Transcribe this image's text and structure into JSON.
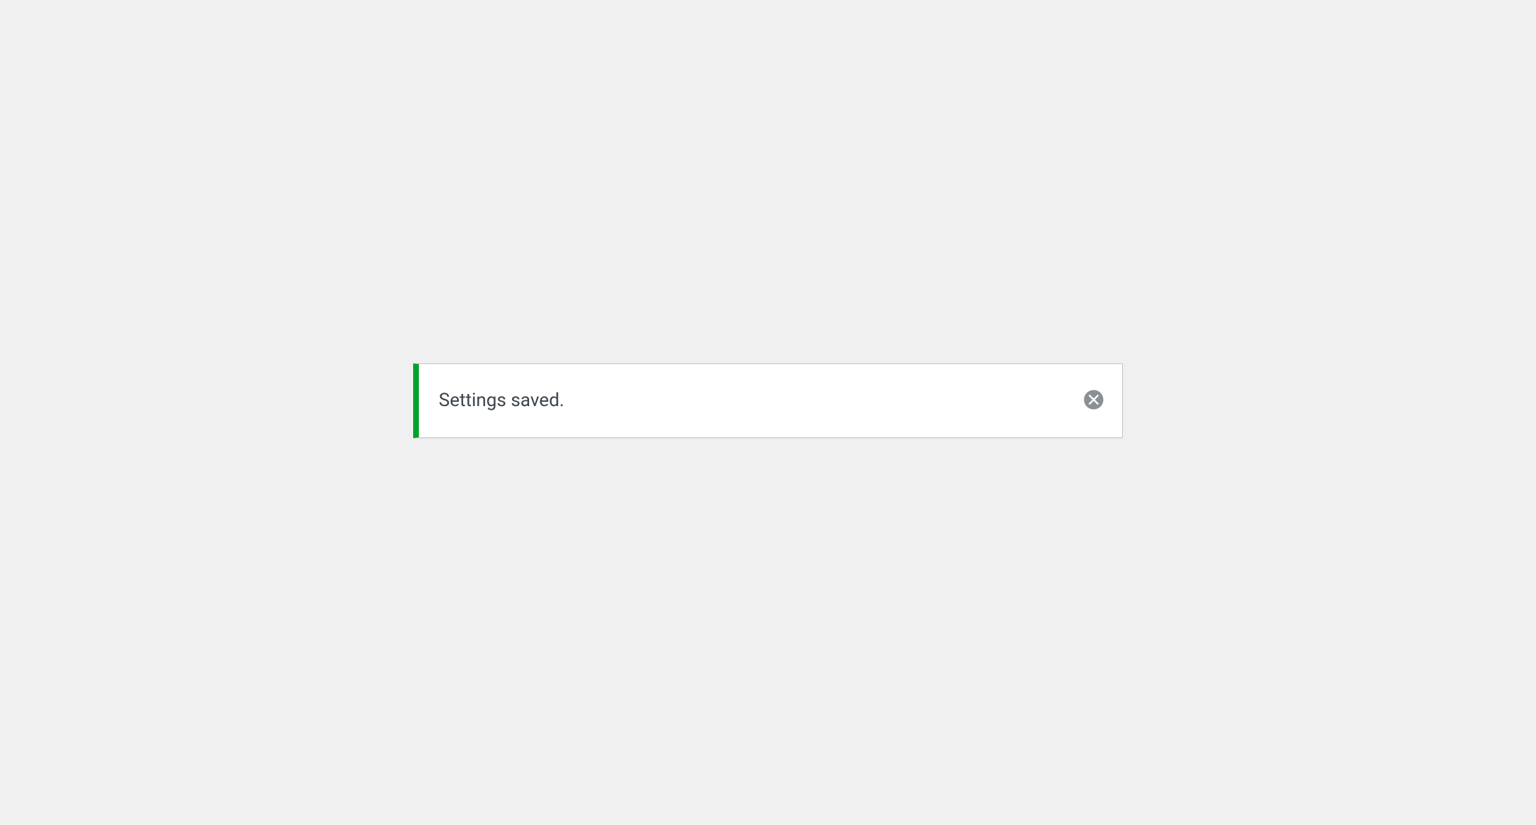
{
  "notice": {
    "message": "Settings saved.",
    "accent_color": "#00a32a"
  }
}
